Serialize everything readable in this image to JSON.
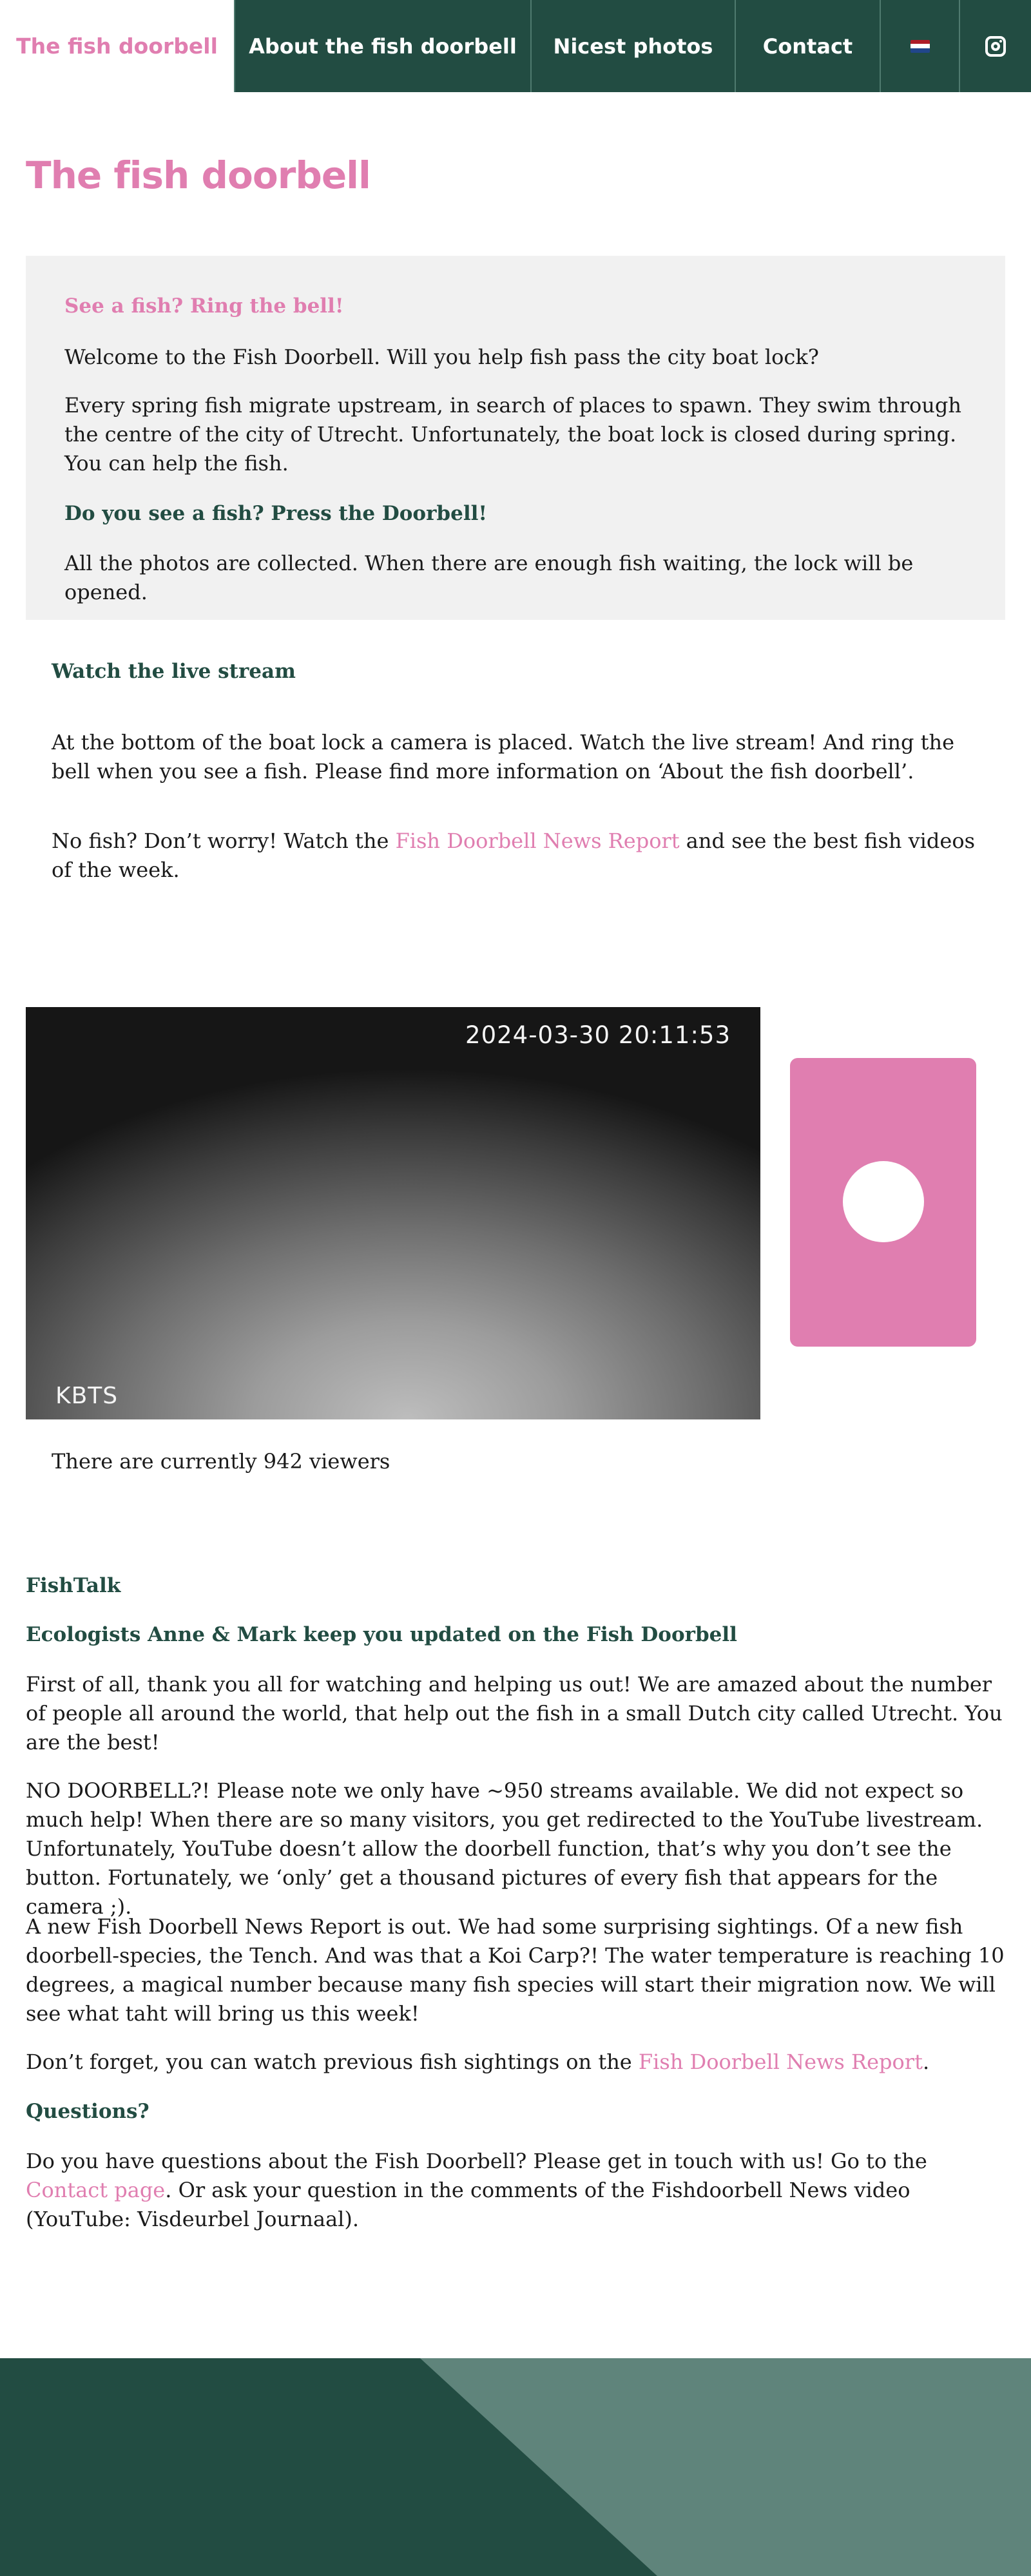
{
  "nav": {
    "brand": "The fish doorbell",
    "items": [
      {
        "label": "About the fish doorbell"
      },
      {
        "label": "Nicest photos"
      },
      {
        "label": "Contact"
      }
    ],
    "language_icon": "netherlands-flag-icon",
    "social_icon": "instagram-icon",
    "colors": {
      "bar": "#224c42",
      "brand": "#e07eb0",
      "flag": [
        "#ae1c28",
        "#ffffff",
        "#21468b"
      ]
    }
  },
  "page_title": "The fish doorbell",
  "intro": {
    "heading": "See a fish? Ring the bell!",
    "welcome": "Welcome to the Fish Doorbell. Will you help fish pass the city boat lock?",
    "migration": "Every spring fish migrate upstream, in search of places to spawn. They swim through the centre of  the city of Utrecht. Unfortunately, the boat lock is closed during spring. You can help the fish.",
    "subheading": "Do you see a fish? Press the Doorbell!",
    "collected": "All the photos are collected. When there are enough fish waiting, the lock will be opened."
  },
  "livestream": {
    "heading": "Watch the live stream",
    "camera_text": "At the bottom of the boat lock a camera is placed. Watch the live stream! And ring the bell when you see a fish. Please find more information on ‘About the fish doorbell’.",
    "no_fish_before": "No fish? Don’t worry! Watch the ",
    "no_fish_link": "Fish Doorbell News Report",
    "no_fish_after": " and see the best fish videos of the week."
  },
  "video": {
    "timestamp": "2024-03-30 20:11:53",
    "tag": "KBTS"
  },
  "doorbell_button": "doorbell-button",
  "viewers": "There are currently 942 viewers",
  "fishtalk": {
    "heading": "FishTalk",
    "subheading": "Ecologists Anne & Mark keep you updated on the Fish Doorbell",
    "thanks": "First of all, thank you all for watching and helping us out! We are amazed about the number of people all around the world, that help out the fish in a small Dutch city called Utrecht. You are the best!",
    "no_doorbell": "NO DOORBELL?! Please note we only have ~950 streams available. We did not expect so much help! When there are so many visitors, you get redirected to the YouTube livestream. Unfortunately, YouTube doesn’t allow the doorbell function, that’s why you don’t see the button. Fortunately, we ‘only’ get a thousand pictures of every fish that appears for the camera ;).",
    "news": "A new Fish Doorbell News Report is out. We had some surprising sightings. Of a new fish doorbell-species, the Tench. And was that a Koi Carp?! The water temperature is reaching 10 degrees, a magical number because many fish species will start their migration now. We will see what taht will bring us this week!",
    "dont_forget_before": "Don’t forget, you can watch previous fish sightings on the ",
    "dont_forget_link": "Fish Doorbell News Report",
    "dont_forget_after": "."
  },
  "questions": {
    "heading": "Questions?",
    "text_before": "Do you have questions about the Fish Doorbell? Please get in touch with us! Go to the ",
    "link": "Contact page",
    "text_after": ". Or ask your question in the comments of the Fishdoorbell News video (YouTube: Visdeurbel Journaal)."
  },
  "footer": {
    "colors": {
      "dark": "#224c42",
      "light": "#5f847b"
    }
  }
}
